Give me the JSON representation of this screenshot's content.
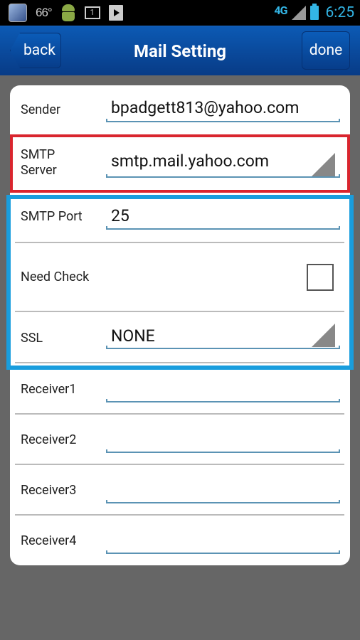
{
  "status_bar": {
    "temperature": "66°",
    "calendar_day": "1",
    "network": "4G",
    "time": "6:25"
  },
  "nav": {
    "back_label": "back",
    "title": "Mail Setting",
    "done_label": "done"
  },
  "form": {
    "sender": {
      "label": "Sender",
      "value": "bpadgett813@yahoo.com"
    },
    "smtp_server": {
      "label_line1": "SMTP",
      "label_line2": "Server",
      "value": "smtp.mail.yahoo.com"
    },
    "smtp_port": {
      "label": "SMTP Port",
      "value": "25"
    },
    "need_check": {
      "label": "Need Check",
      "checked": false
    },
    "ssl": {
      "label": "SSL",
      "value": "NONE"
    },
    "receivers": [
      {
        "label": "Receiver1",
        "value": ""
      },
      {
        "label": "Receiver2",
        "value": ""
      },
      {
        "label": "Receiver3",
        "value": ""
      },
      {
        "label": "Receiver4",
        "value": ""
      }
    ]
  },
  "colors": {
    "nav_blue": "#0a4ea3",
    "highlight_red": "#d9252e",
    "highlight_blue": "#199ddd",
    "underline": "#5b93b4"
  }
}
